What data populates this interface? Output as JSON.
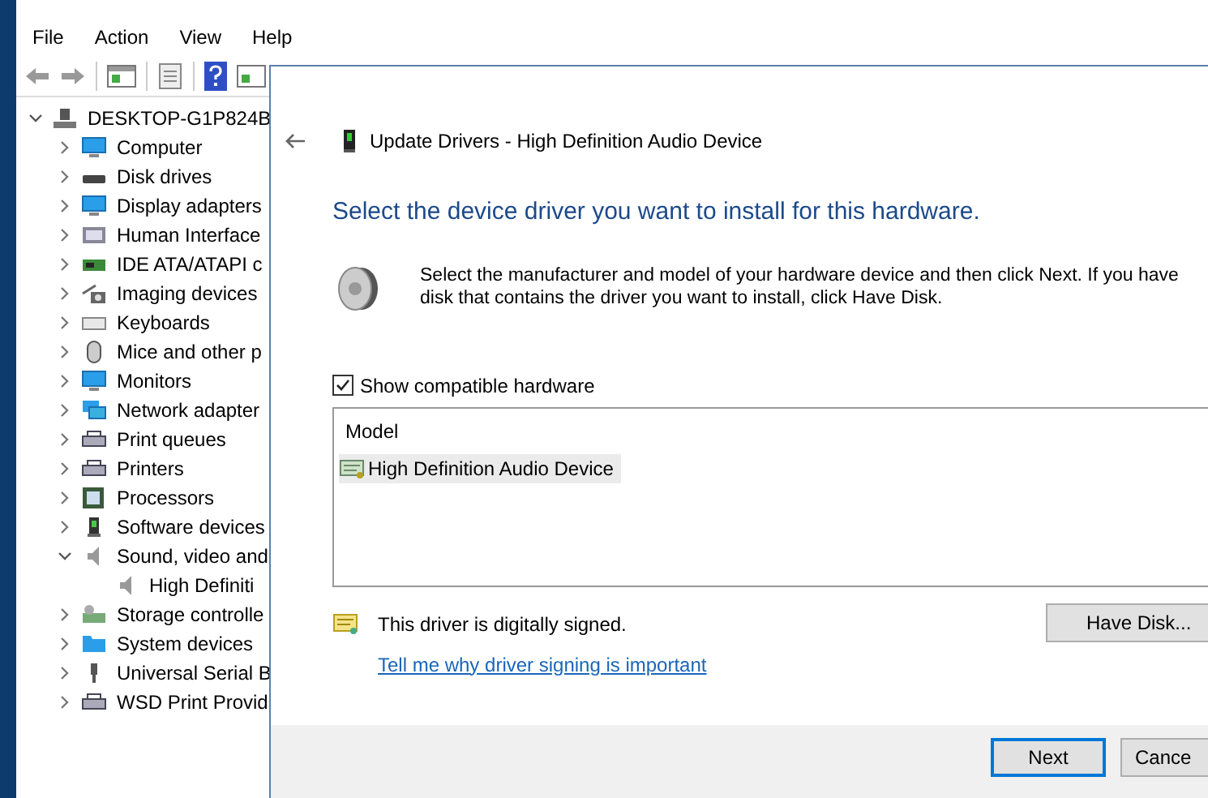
{
  "menu": [
    "File",
    "Action",
    "View",
    "Help"
  ],
  "tree": {
    "label": "DESKTOP-G1P824B",
    "kind": "computer",
    "expanded": true,
    "children": [
      {
        "label": "Computer",
        "kind": "monitor",
        "expanded": false
      },
      {
        "label": "Disk drives",
        "kind": "disk",
        "expanded": false
      },
      {
        "label": "Display adapters",
        "kind": "monitor",
        "expanded": false
      },
      {
        "label": "Human Interface",
        "kind": "hid",
        "expanded": false
      },
      {
        "label": "IDE ATA/ATAPI c",
        "kind": "card",
        "expanded": false
      },
      {
        "label": "Imaging devices",
        "kind": "camera",
        "expanded": false
      },
      {
        "label": "Keyboards",
        "kind": "keyboard",
        "expanded": false
      },
      {
        "label": "Mice and other p",
        "kind": "mouse",
        "expanded": false
      },
      {
        "label": "Monitors",
        "kind": "monitor",
        "expanded": false
      },
      {
        "label": "Network adapter",
        "kind": "network",
        "expanded": false
      },
      {
        "label": "Print queues",
        "kind": "printer",
        "expanded": false
      },
      {
        "label": "Printers",
        "kind": "printer",
        "expanded": false
      },
      {
        "label": "Processors",
        "kind": "chip",
        "expanded": false
      },
      {
        "label": "Software devices",
        "kind": "device",
        "expanded": false
      },
      {
        "label": "Sound, video and",
        "kind": "speaker",
        "expanded": true,
        "children": [
          {
            "label": "High Definiti",
            "kind": "speaker"
          }
        ]
      },
      {
        "label": "Storage controlle",
        "kind": "storage",
        "expanded": false
      },
      {
        "label": "System devices",
        "kind": "folder",
        "expanded": false
      },
      {
        "label": "Universal Serial B",
        "kind": "usb",
        "expanded": false
      },
      {
        "label": "WSD Print Provid",
        "kind": "printer",
        "expanded": false
      }
    ]
  },
  "dialog": {
    "title": "Update Drivers - High Definition Audio Device",
    "heading": "Select the device driver you want to install for this hardware.",
    "description": "Select the manufacturer and model of your hardware device and then click Next. If you have disk that contains the driver you want to install, click Have Disk.",
    "checkbox": {
      "label": "Show compatible hardware",
      "checked": true
    },
    "model_list": {
      "column": "Model",
      "items": [
        {
          "label": "High Definition Audio Device",
          "selected": true
        }
      ]
    },
    "signed_note": "This driver is digitally signed.",
    "link": "Tell me why driver signing is important",
    "have_disk_button": "Have Disk...",
    "buttons": [
      {
        "label": "Next",
        "default": true
      },
      {
        "label": "Cance",
        "default": false
      }
    ]
  }
}
